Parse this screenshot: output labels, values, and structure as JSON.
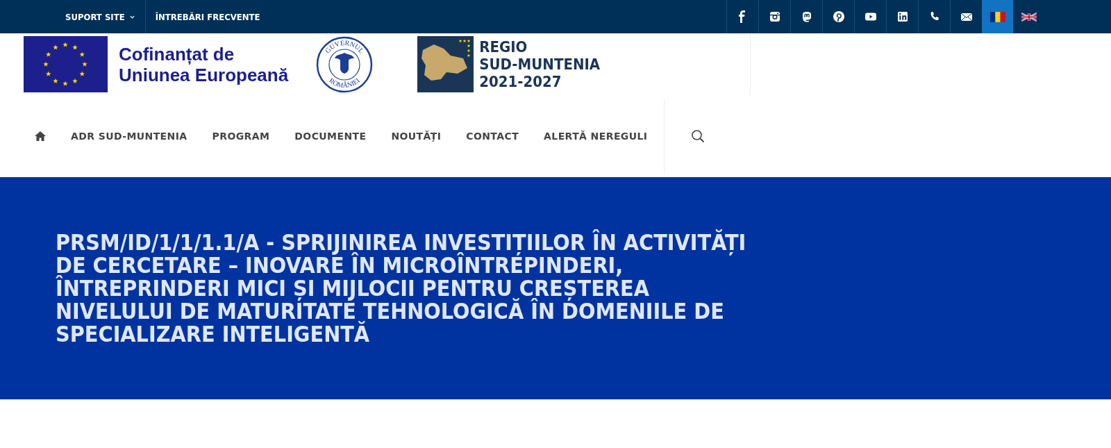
{
  "top_bar": {
    "links": [
      {
        "label": "SUPORT SITE",
        "kind": "dropdown"
      },
      {
        "label": "ÎNTREBĂRI FRECVENTE",
        "kind": "link"
      }
    ],
    "social": [
      {
        "kind": "facebook"
      },
      {
        "kind": "instagram"
      },
      {
        "kind": "mastodon"
      },
      {
        "kind": "pinterest"
      },
      {
        "kind": "youtube"
      },
      {
        "kind": "linkedin"
      },
      {
        "kind": "phone"
      },
      {
        "kind": "mail"
      }
    ],
    "languages": [
      {
        "kind": "ro",
        "selected": true
      },
      {
        "kind": "en",
        "selected": false
      }
    ]
  },
  "logos": {
    "eu": {
      "line_1": "Cofinanțat de",
      "line_2": "Uniunea Europeană"
    },
    "gov": {
      "top": "GUVERNUL",
      "bottom": "ROMÂNIEI"
    },
    "regio": {
      "lines": [
        "REGIO",
        "SUD-MUNTENIA",
        "2021-2027"
      ]
    }
  },
  "nav": {
    "items": [
      "ADR SUD-MUNTENIA",
      "PROGRAM",
      "DOCUMENTE",
      "NOUTĂȚI",
      "CONTACT",
      "ALERTĂ NEREGULI"
    ]
  },
  "hero": {
    "title": "PRSM/ID/1/1/1.1/A - SPRIJINIREA INVESTIȚIILOR ÎN ACTIVITĂȚI DE CERCETARE – INOVARE ÎN MICROÎNTREPINDERI, ÎNTREPRINDERI MICI ȘI MIJLOCII PENTRU CREȘTEREA NIVELULUI DE MATURITATE TEHNOLOGICĂ ÎN DOMENIILE DE SPECIALIZARE INTELIGENTĂ"
  }
}
